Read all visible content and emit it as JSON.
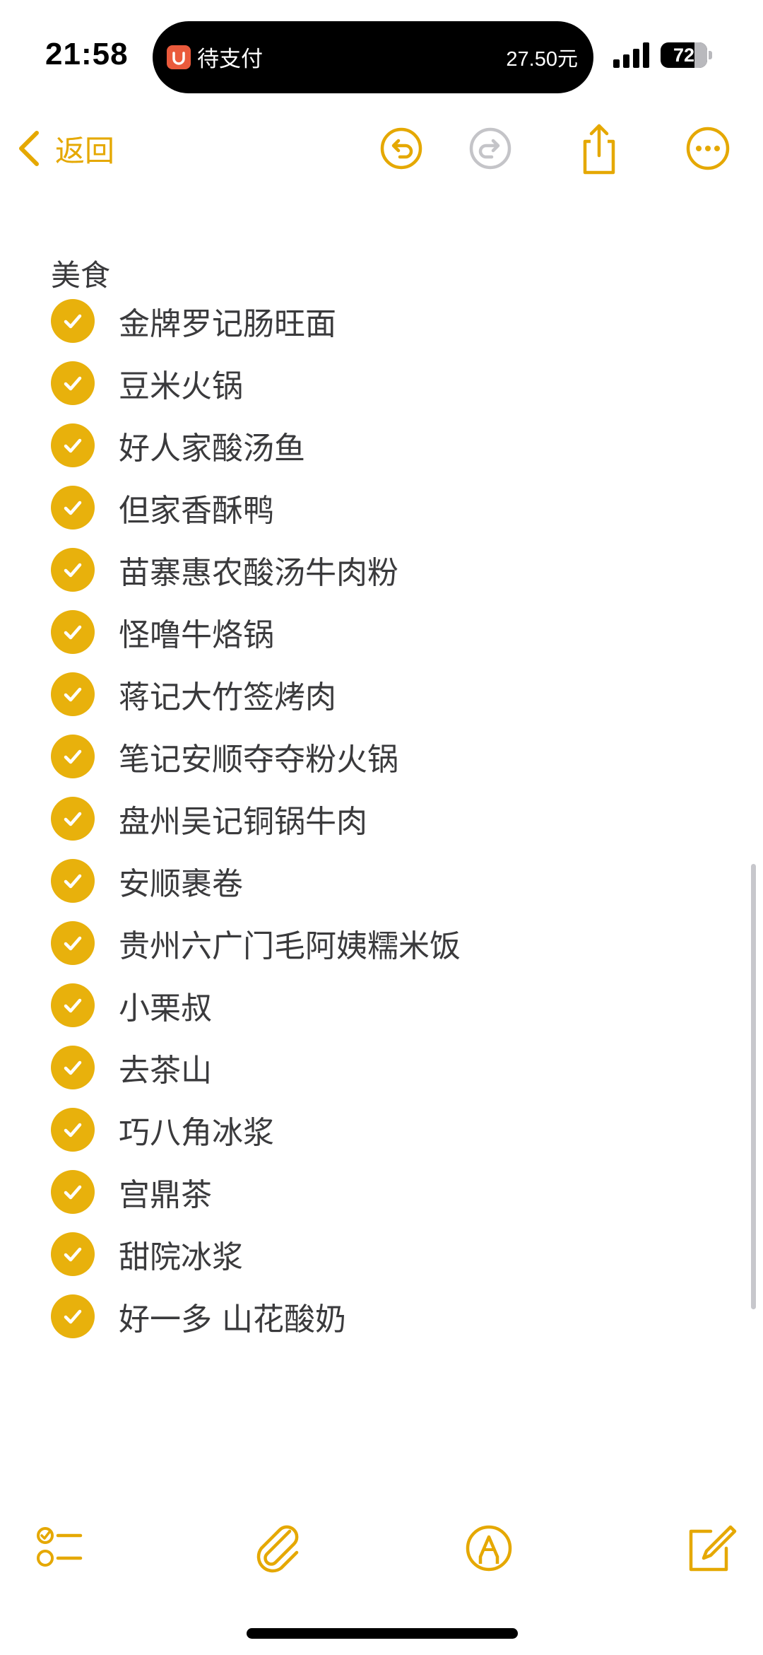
{
  "status_bar": {
    "time": "21:58",
    "island_label": "待支付",
    "island_amount": "27.50元",
    "battery_level": "72",
    "battery_fraction": 0.72
  },
  "nav": {
    "back_label": "返回"
  },
  "note": {
    "title": "美食",
    "items": [
      {
        "text": "金牌罗记肠旺面",
        "checked": true
      },
      {
        "text": "豆米火锅",
        "checked": true
      },
      {
        "text": "好人家酸汤鱼",
        "checked": true
      },
      {
        "text": "但家香酥鸭",
        "checked": true
      },
      {
        "text": "苗寨惠农酸汤牛肉粉",
        "checked": true
      },
      {
        "text": "怪噜牛烙锅",
        "checked": true
      },
      {
        "text": "蒋记大竹签烤肉",
        "checked": true
      },
      {
        "text": "笔记安顺夺夺粉火锅",
        "checked": true
      },
      {
        "text": "盘州吴记铜锅牛肉",
        "checked": true
      },
      {
        "text": "安顺裹卷",
        "checked": true
      },
      {
        "text": "贵州六广门毛阿姨糯米饭",
        "checked": true
      },
      {
        "text": "小栗叔",
        "checked": true
      },
      {
        "text": "去茶山",
        "checked": true
      },
      {
        "text": "巧八角冰浆",
        "checked": true
      },
      {
        "text": "宫鼎茶",
        "checked": true
      },
      {
        "text": "甜院冰浆",
        "checked": true
      },
      {
        "text": "好一多 山花酸奶",
        "checked": true
      }
    ]
  },
  "icons": {
    "back": "chevron-left-icon",
    "undo": "undo-icon",
    "redo": "redo-icon",
    "share": "share-icon",
    "more": "ellipsis-icon",
    "checklist": "checklist-icon",
    "attach": "paperclip-icon",
    "markup": "markup-pen-icon",
    "compose": "compose-icon"
  },
  "colors": {
    "accent": "#e5a800",
    "check_fill": "#e8b10c",
    "disabled": "#c4c4c8",
    "text": "#3a3a3c"
  }
}
